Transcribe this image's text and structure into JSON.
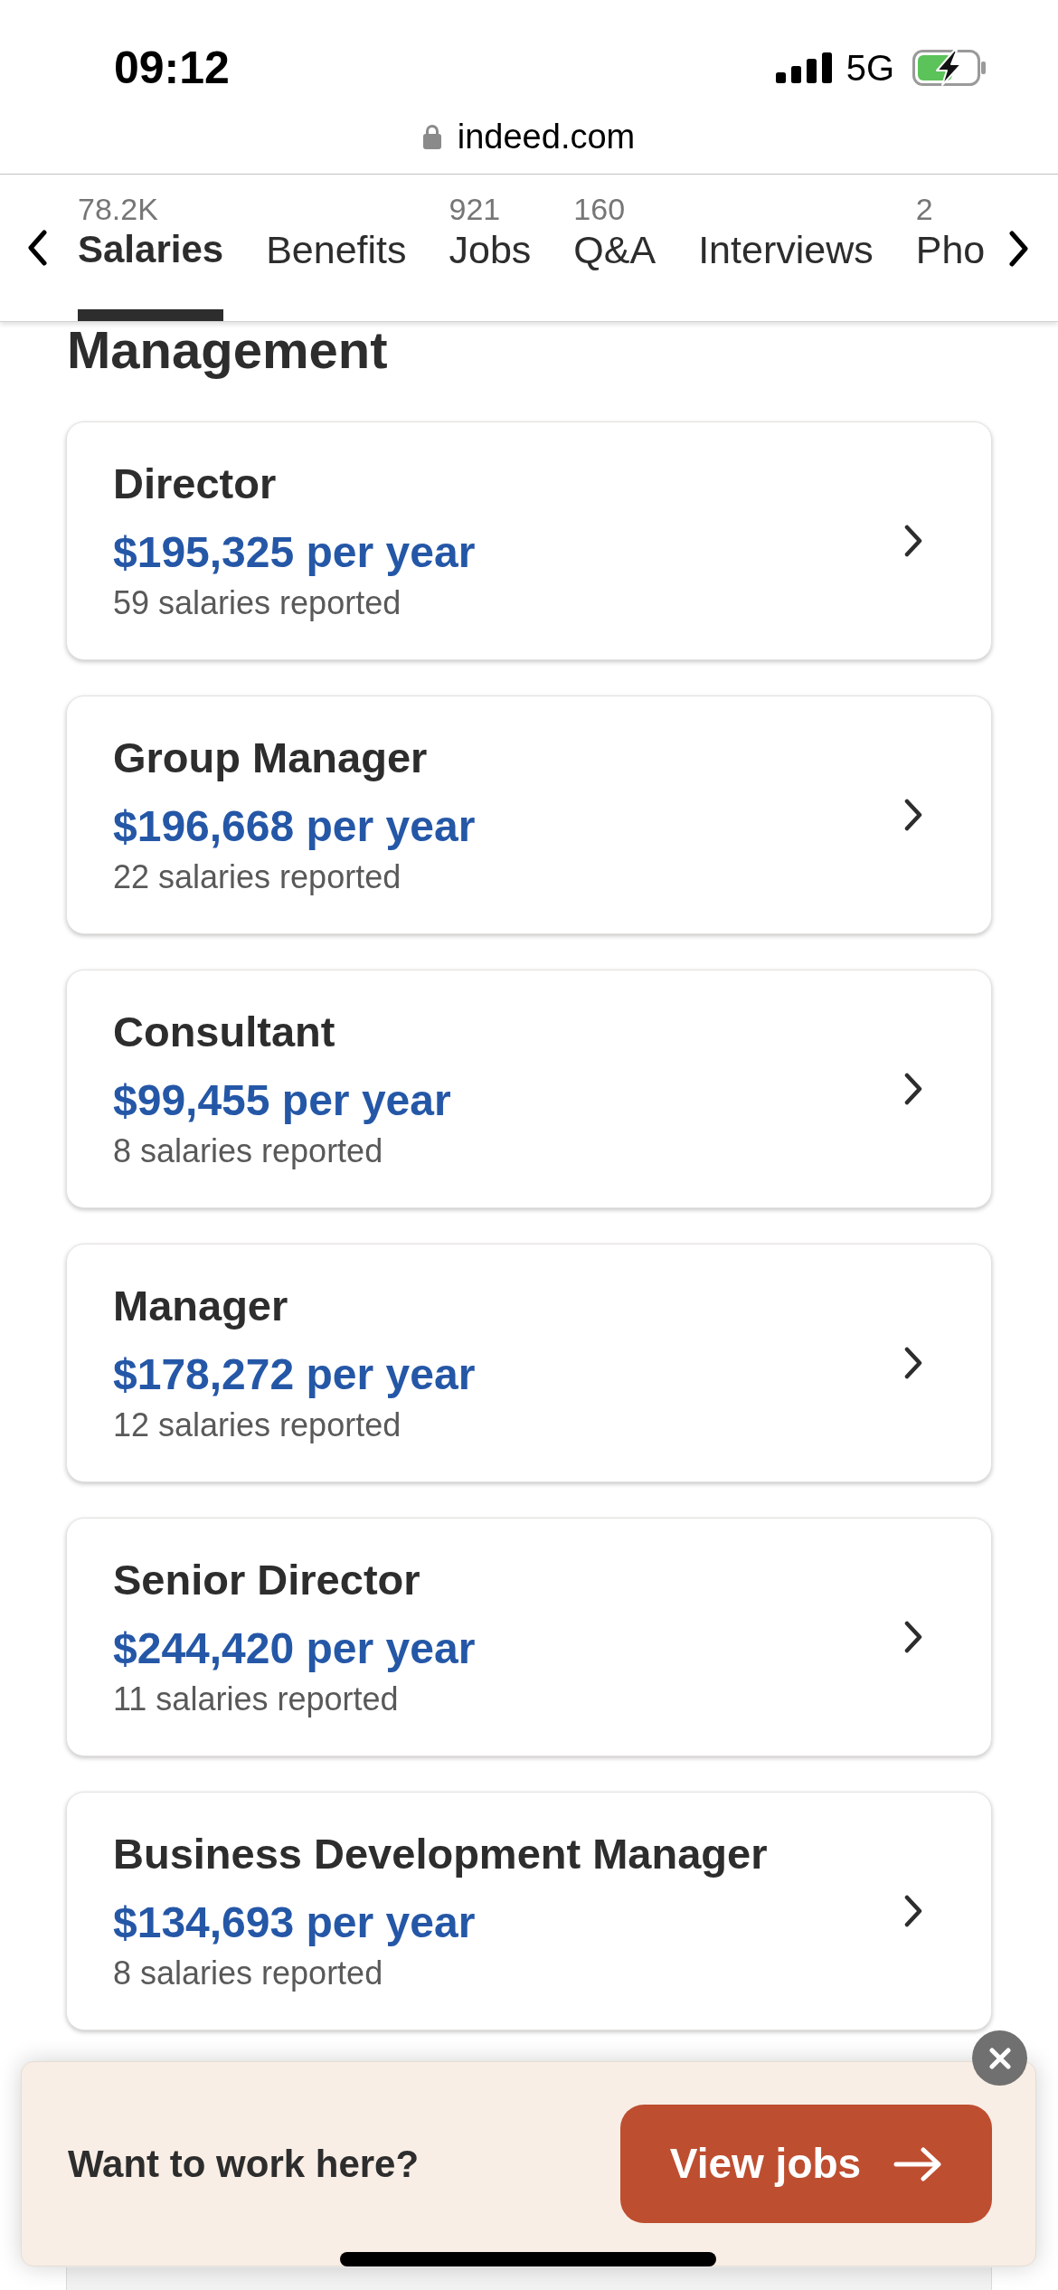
{
  "status_bar": {
    "time": "09:12",
    "network": "5G"
  },
  "address_bar": {
    "url": "indeed.com"
  },
  "tabs": [
    {
      "count": "78.2K",
      "label": "Salaries",
      "selected": true
    },
    {
      "label": "Benefits",
      "selected": false
    },
    {
      "count": "921",
      "label": "Jobs",
      "selected": false
    },
    {
      "count": "160",
      "label": "Q&A",
      "selected": false
    },
    {
      "label": "Interviews",
      "selected": false
    },
    {
      "count": "2",
      "label": "Pho",
      "selected": false
    }
  ],
  "section": {
    "title": "Management"
  },
  "salary_cards": [
    {
      "title": "Director",
      "salary": "$195,325 per year",
      "reports": "59 salaries reported"
    },
    {
      "title": "Group Manager",
      "salary": "$196,668 per year",
      "reports": "22 salaries reported"
    },
    {
      "title": "Consultant",
      "salary": "$99,455 per year",
      "reports": "8 salaries reported"
    },
    {
      "title": "Manager",
      "salary": "$178,272 per year",
      "reports": "12 salaries reported"
    },
    {
      "title": "Senior Director",
      "salary": "$244,420 per year",
      "reports": "11 salaries reported"
    },
    {
      "title": "Business Development Manager",
      "salary": "$134,693 per year",
      "reports": "8 salaries reported"
    }
  ],
  "banner": {
    "text": "Want to work here?",
    "button": "View jobs"
  }
}
